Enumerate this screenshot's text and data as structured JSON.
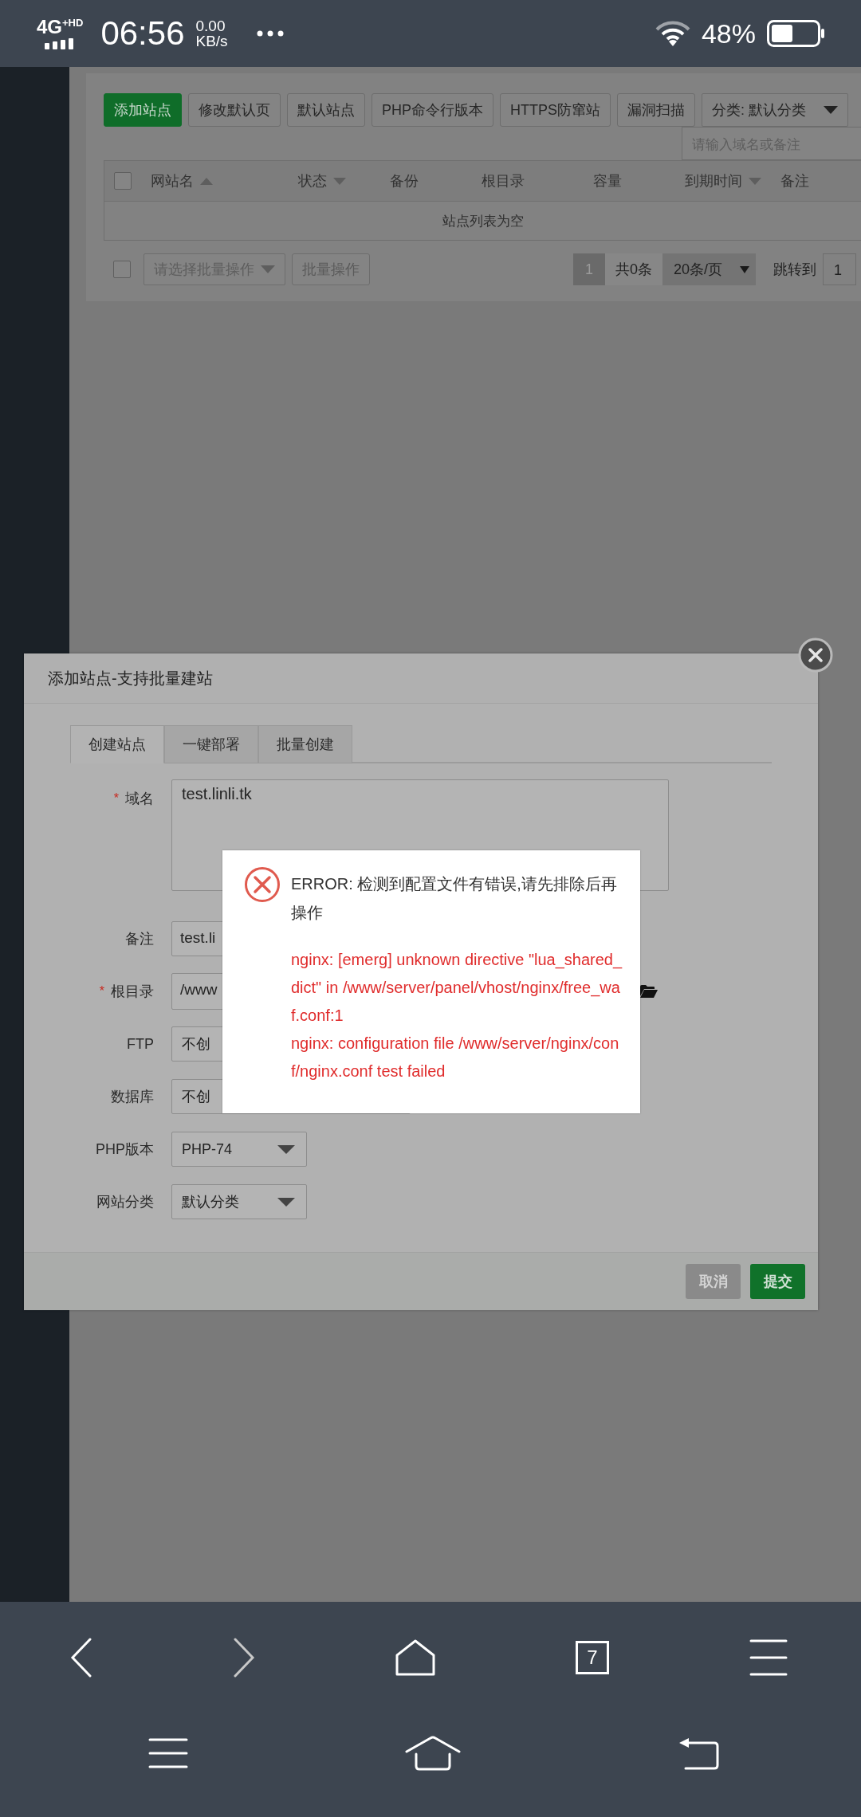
{
  "status_bar": {
    "network": "4G",
    "network_extra": "+HD",
    "time": "06:56",
    "speed": "0.00",
    "speed_unit": "KB/s",
    "battery": "48%"
  },
  "toolbar": {
    "buttons": [
      {
        "label": "添加站点",
        "kind": "primary"
      },
      {
        "label": "修改默认页",
        "kind": "default"
      },
      {
        "label": "默认站点",
        "kind": "default"
      },
      {
        "label": "PHP命令行版本",
        "kind": "default"
      },
      {
        "label": "HTTPS防窜站",
        "kind": "default"
      },
      {
        "label": "漏洞扫描",
        "kind": "default"
      }
    ],
    "category": "分类: 默认分类",
    "search": {
      "placeholder": "请输入域名或备注"
    }
  },
  "table": {
    "checked": false,
    "columns": [
      {
        "label": "网站名",
        "kind": "sort-up"
      },
      {
        "label": "状态",
        "kind": "sort-down"
      },
      {
        "label": "备份",
        "kind": "plain"
      },
      {
        "label": "根目录",
        "kind": "plain"
      },
      {
        "label": "容量",
        "kind": "plain"
      },
      {
        "label": "到期时间",
        "kind": "sort-down"
      },
      {
        "label": "备注",
        "kind": "plain"
      }
    ],
    "empty_text": "站点列表为空"
  },
  "table_footer": {
    "checked": false,
    "batch_placeholder": "请选择批量操作",
    "batch_button": "批量操作",
    "current_page": "1",
    "total": "共0条",
    "page_size": "20条/页",
    "jump_label": "跳转到",
    "jump_value": "1"
  },
  "dialog": {
    "title": "添加站点-支持批量建站",
    "tabs": [
      {
        "label": "创建站点",
        "selected": true
      },
      {
        "label": "一键部署",
        "selected": false
      },
      {
        "label": "批量创建",
        "selected": false
      }
    ],
    "fields": [
      {
        "label": "域名",
        "required_mark": "*",
        "kind": "textarea",
        "value": "test.linli.tk"
      },
      {
        "label": "备注",
        "kind": "input",
        "value": "test.li"
      },
      {
        "label": "根目录",
        "required_mark": "*",
        "kind": "path",
        "value": "/www"
      },
      {
        "label": "FTP",
        "kind": "select-partial",
        "value": "不创"
      },
      {
        "label": "数据库",
        "kind": "select-partial",
        "value": "不创"
      },
      {
        "label": "PHP版本",
        "kind": "select",
        "value": "PHP-74"
      },
      {
        "label": "网站分类",
        "kind": "select",
        "value": "默认分类"
      }
    ],
    "buttons": [
      {
        "label": "取消",
        "kind": "cancel"
      },
      {
        "label": "提交",
        "kind": "submit"
      }
    ]
  },
  "error": {
    "heading": "ERROR: 检测到配置文件有错误,请先排除后再操作",
    "details": [
      "nginx: [emerg] unknown directive \"lua_shared_dict\" in /www/server/panel/vhost/nginx/free_waf.conf:1",
      "nginx: configuration file /www/server/nginx/conf/nginx.conf test failed"
    ]
  },
  "browser_bar": {
    "tab_count": "7"
  }
}
